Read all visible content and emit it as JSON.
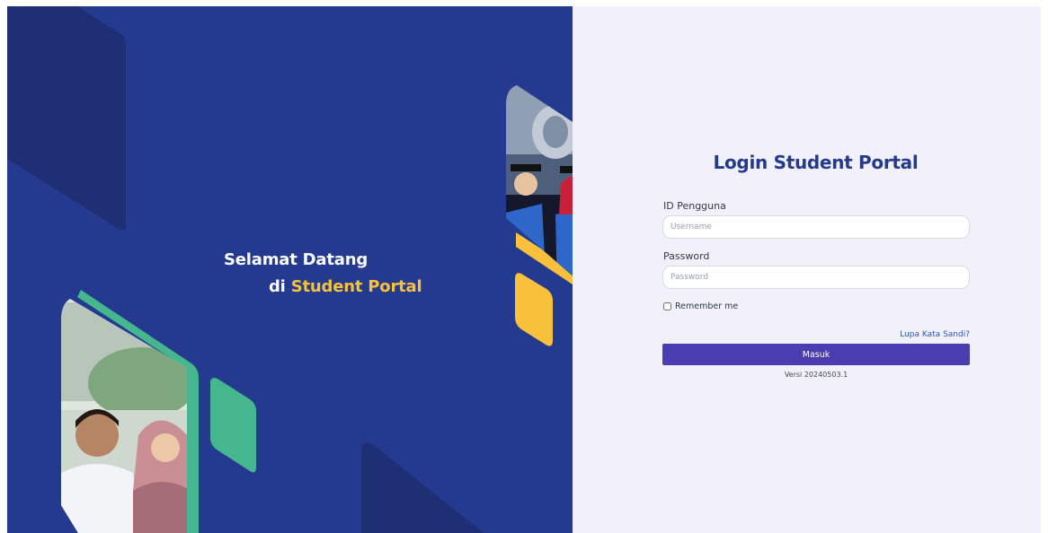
{
  "welcome": {
    "line1": "Selamat Datang",
    "line2_prefix": "di ",
    "line2_accent": "Student Portal"
  },
  "login": {
    "title": "Login Student Portal",
    "username": {
      "label": "ID Pengguna",
      "placeholder": "Username",
      "value": ""
    },
    "password": {
      "label": "Password",
      "placeholder": "Password",
      "value": ""
    },
    "remember_label": "Remember me",
    "remember_checked": false,
    "forgot_label": "Lupa Kata Sandi?",
    "submit_label": "Masuk",
    "version": "Versi 20240503.1"
  },
  "colors": {
    "left_bg": "#233a8f",
    "right_bg": "#f1f0fb",
    "accent_yellow": "#f9c13b",
    "accent_green": "#46b68f",
    "button": "#4a3db0",
    "title": "#233a8f"
  },
  "images": {
    "graduates_photo": "photo of two graduates in gowns",
    "students_photo": "photo of two smiling students"
  }
}
